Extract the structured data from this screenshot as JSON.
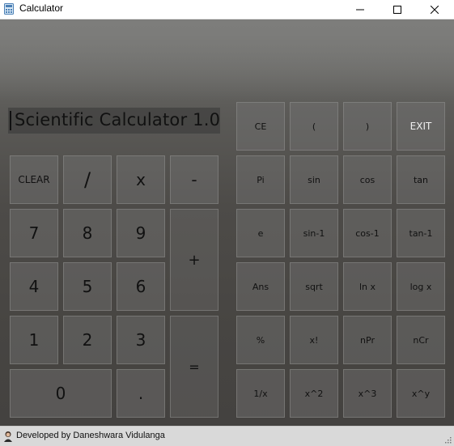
{
  "window": {
    "title": "Calculator"
  },
  "display": {
    "text": "Scientific Calculator 1.0"
  },
  "keys": {
    "clear": "CLEAR",
    "divide": "/",
    "multiply": "x",
    "minus": "-",
    "seven": "7",
    "eight": "8",
    "nine": "9",
    "plus": "+",
    "four": "4",
    "five": "5",
    "six": "6",
    "one": "1",
    "two": "2",
    "three": "3",
    "equals": "=",
    "zero": "0",
    "dot": ".",
    "ce": "CE",
    "lparen": "(",
    "rparen": ")",
    "exit": "EXIT",
    "pi": "Pi",
    "sin": "sin",
    "cos": "cos",
    "tan": "tan",
    "e": "e",
    "asin": "sin-1",
    "acos": "cos-1",
    "atan": "tan-1",
    "ans": "Ans",
    "sqrt": "sqrt",
    "ln": "ln x",
    "log": "log x",
    "percent": "%",
    "fact": "x!",
    "npr": "nPr",
    "ncr": "nCr",
    "recip": "1/x",
    "square": "x^2",
    "cube": "x^3",
    "pow": "x^y"
  },
  "status": {
    "text": "Developed by Daneshwara Vidulanga"
  },
  "icons": {
    "app": "calculator-icon",
    "minimize": "minimize-icon",
    "maximize": "maximize-icon",
    "close": "close-icon",
    "developer": "avatar-icon",
    "resize": "resize-grip-icon"
  }
}
